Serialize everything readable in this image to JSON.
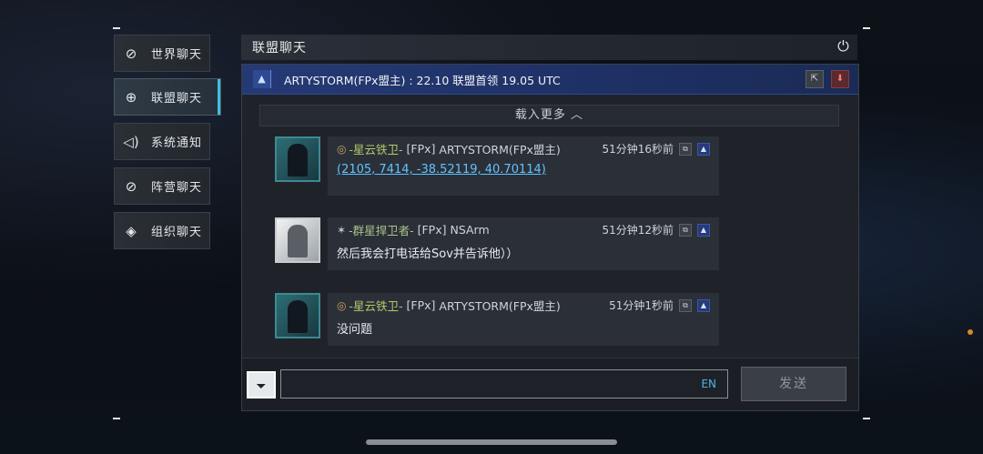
{
  "tabs": [
    {
      "label": "世界聊天",
      "icon": "planet-icon"
    },
    {
      "label": "联盟聊天",
      "icon": "globe-icon"
    },
    {
      "label": "系统通知",
      "icon": "speaker-icon"
    },
    {
      "label": "阵营聊天",
      "icon": "planet-icon"
    },
    {
      "label": "组织聊天",
      "icon": "handshake-icon"
    }
  ],
  "panel": {
    "title": "联盟聊天"
  },
  "pinned": {
    "text": "ARTYSTORM(FPx盟主) : 22.10 联盟首领 19.05 UTC"
  },
  "load_more": "载入更多 ︿",
  "messages": [
    {
      "alliance": "-星云铁卫-",
      "tag": "[FPx]",
      "name": "ARTYSTORM(FPx盟主)",
      "time": "51分钟16秒前",
      "body": "(2105, 7414, -38.52119, 40.70114)"
    },
    {
      "alliance": "-群星捍卫者-",
      "tag": "[FPx]",
      "name": "NSArm",
      "time": "51分钟12秒前",
      "body": "然后我会打电话给Sov并告诉他））"
    },
    {
      "alliance": "-星云铁卫-",
      "tag": "[FPx]",
      "name": "ARTYSTORM(FPx盟主)",
      "time": "51分钟1秒前",
      "body": "没问题"
    }
  ],
  "input": {
    "lang": "EN",
    "send_label": "发送"
  }
}
